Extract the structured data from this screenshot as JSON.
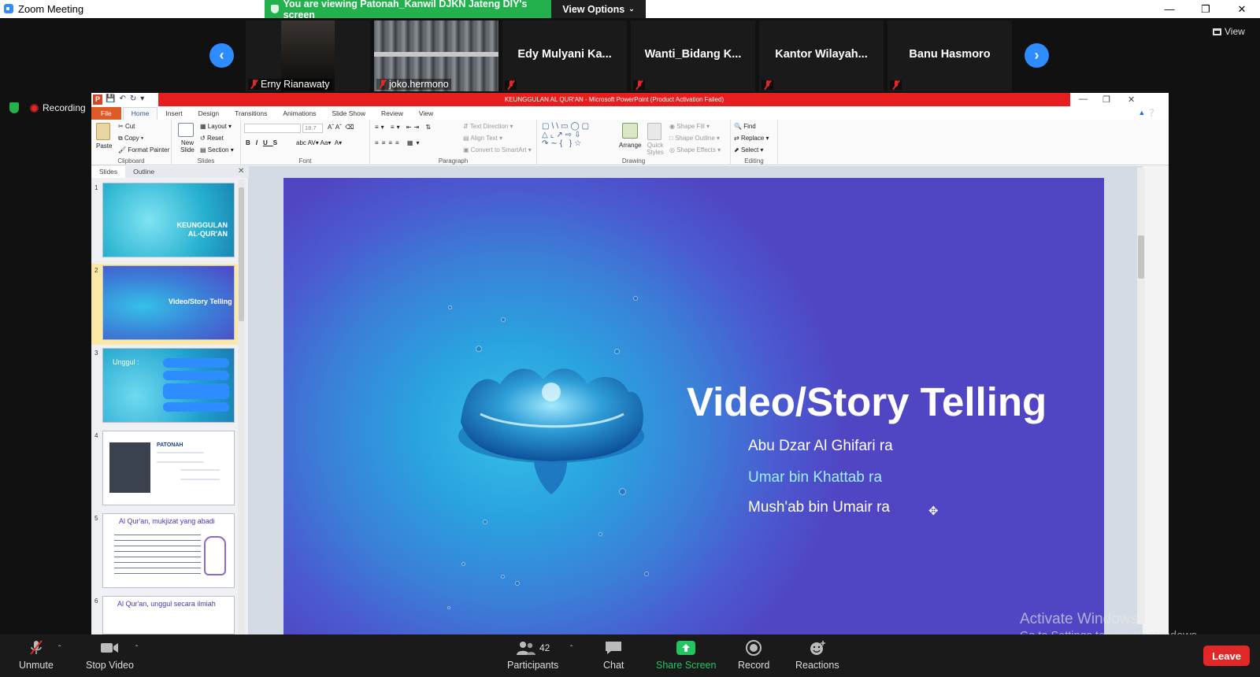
{
  "window": {
    "title": "Zoom Meeting",
    "viewing_banner": "You are viewing Patonah_Kanwil DJKN Jateng DIY's screen",
    "view_options": "View Options",
    "view": "View",
    "recording": "Recording"
  },
  "gallery": {
    "participants": [
      {
        "name": "Erny Rianawaty",
        "type": "video"
      },
      {
        "name": "joko.hermono",
        "type": "video"
      },
      {
        "name": "Edy Mulyani  Ka...",
        "type": "name"
      },
      {
        "name": "Wanti_Bidang  K...",
        "type": "name"
      },
      {
        "name": "Kantor  Wilayah...",
        "type": "name"
      },
      {
        "name": "Banu Hasmoro",
        "type": "name"
      }
    ]
  },
  "ppt": {
    "title": "KEUNGGULAN AL QUR'AN  -  Microsoft PowerPoint (Product Activation Failed)",
    "tabs": [
      "File",
      "Home",
      "Insert",
      "Design",
      "Transitions",
      "Animations",
      "Slide Show",
      "Review",
      "View"
    ],
    "active_tab": "Home",
    "ribbon": {
      "clipboard": {
        "name": "Clipboard",
        "paste": "Paste",
        "cut": "Cut",
        "copy": "Copy",
        "format_painter": "Format Painter"
      },
      "slides": {
        "name": "Slides",
        "new_slide": "New Slide",
        "layout": "Layout",
        "reset": "Reset",
        "section": "Section"
      },
      "font": {
        "name": "Font",
        "size": "18.7"
      },
      "paragraph": {
        "name": "Paragraph",
        "text_direction": "Text Direction",
        "align_text": "Align Text",
        "convert": "Convert to SmartArt"
      },
      "drawing": {
        "name": "Drawing",
        "arrange": "Arrange",
        "quick_styles": "Quick Styles",
        "shape_fill": "Shape Fill",
        "shape_outline": "Shape Outline",
        "shape_effects": "Shape Effects"
      },
      "editing": {
        "name": "Editing",
        "find": "Find",
        "replace": "Replace",
        "select": "Select"
      }
    },
    "pane_tabs": [
      "Slides",
      "Outline"
    ],
    "thumbnails": [
      {
        "num": "1",
        "text": "KEUNGGULAN AL-QUR'AN"
      },
      {
        "num": "2",
        "text": "Video/Story Telling"
      },
      {
        "num": "3",
        "text": "Unggul :"
      },
      {
        "num": "4",
        "text": "PATONAH"
      },
      {
        "num": "5",
        "text": "Al Qur'an, mukjizat yang abadi"
      },
      {
        "num": "6",
        "text": "Al Qur'an, unggul secara ilmiah"
      }
    ],
    "slide": {
      "title": "Video/Story Telling",
      "lines": [
        "Abu Dzar Al Ghifari ra",
        "Umar bin Khattab ra",
        "Mush'ab bin Umair ra"
      ]
    }
  },
  "activation": {
    "line1": "Activate Windows",
    "line2": "Go to Settings to activate Windows."
  },
  "toolbar": {
    "unmute": "Unmute",
    "stop_video": "Stop Video",
    "participants": "Participants",
    "participant_count": "42",
    "chat": "Chat",
    "share_screen": "Share Screen",
    "record": "Record",
    "reactions": "Reactions",
    "leave": "Leave"
  },
  "colors": {
    "zoom_blue": "#2d8cff",
    "banner_green": "#22b14c",
    "leave_red": "#e02828",
    "ppt_title_red": "#e81e1e"
  }
}
